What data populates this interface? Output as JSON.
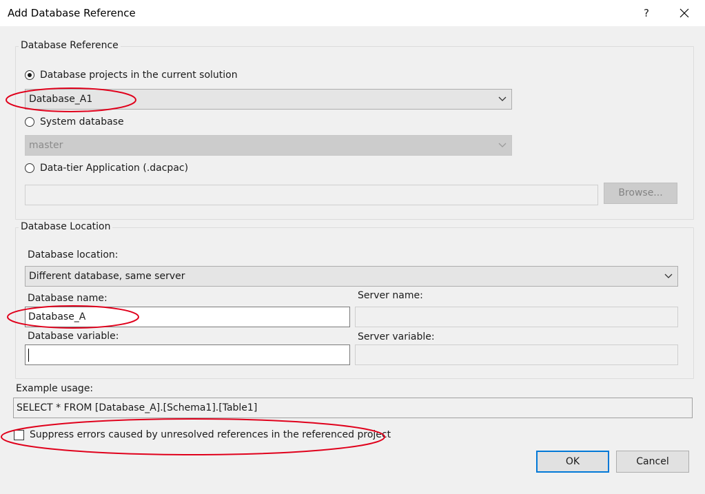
{
  "window": {
    "title": "Add Database Reference",
    "help_label": "?"
  },
  "reference_group": {
    "legend": "Database Reference",
    "option_projects": "Database projects in the current solution",
    "project_selected": "Database_A1",
    "option_system": "System database",
    "system_selected": "master",
    "option_dacpac": "Data-tier Application (.dacpac)",
    "dacpac_path": "",
    "browse_label": "Browse..."
  },
  "location_group": {
    "legend": "Database Location",
    "location_label": "Database location:",
    "location_selected": "Different database, same server",
    "db_name_label": "Database name:",
    "db_name_value": "Database_A",
    "server_name_label": "Server name:",
    "server_name_value": "",
    "db_variable_label": "Database variable:",
    "db_variable_value": "",
    "server_variable_label": "Server variable:",
    "server_variable_value": ""
  },
  "example": {
    "label": "Example usage:",
    "value": "SELECT * FROM [Database_A].[Schema1].[Table1]"
  },
  "suppress_label": "Suppress errors caused by unresolved references in the referenced project",
  "buttons": {
    "ok": "OK",
    "cancel": "Cancel"
  },
  "colors": {
    "annotation": "#e0001b",
    "default_button_border": "#0078d7"
  }
}
